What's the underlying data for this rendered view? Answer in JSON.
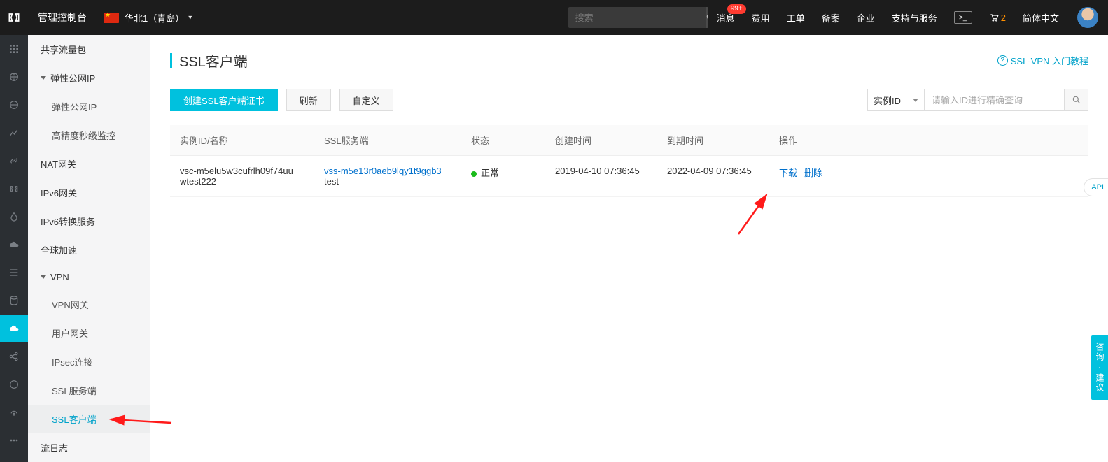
{
  "header": {
    "console_label": "管理控制台",
    "region": "华北1（青岛）",
    "search_placeholder": "搜索",
    "msg_label": "消息",
    "msg_badge": "99+",
    "fee_label": "费用",
    "ticket_label": "工单",
    "beian_label": "备案",
    "enterprise_label": "企业",
    "support_label": "支持与服务",
    "cart_count": "2",
    "lang_label": "简体中文"
  },
  "sidebar": {
    "shared_flow": "共享流量包",
    "eip_group": "弹性公网IP",
    "eip": "弹性公网IP",
    "hp_monitor": "高精度秒级监控",
    "nat": "NAT网关",
    "ipv6gw": "IPv6网关",
    "ipv6trans": "IPv6转换服务",
    "global_accel": "全球加速",
    "vpn_group": "VPN",
    "vpn_gw": "VPN网关",
    "user_gw": "用户网关",
    "ipsec": "IPsec连接",
    "ssl_server": "SSL服务端",
    "ssl_client": "SSL客户端",
    "flow_log": "流日志"
  },
  "page": {
    "title": "SSL客户端",
    "help_link": "SSL-VPN 入门教程"
  },
  "toolbar": {
    "create_btn": "创建SSL客户端证书",
    "refresh_btn": "刷新",
    "custom_btn": "自定义",
    "filter_type": "实例ID",
    "filter_placeholder": "请输入ID进行精确查询"
  },
  "table": {
    "headers": {
      "id_name": "实例ID/名称",
      "ssl_server": "SSL服务端",
      "status": "状态",
      "create_time": "创建时间",
      "expire_time": "到期时间",
      "ops": "操作"
    },
    "row": {
      "id": "vsc-m5elu5w3cufrlh09f74uu",
      "name": "wtest222",
      "ssl_server_id": "vss-m5e13r0aeb9lqy1t9ggb3",
      "ssl_server_name": "test",
      "status": "正常",
      "create_time": "2019-04-10 07:36:45",
      "expire_time": "2022-04-09 07:36:45",
      "op_download": "下载",
      "op_delete": "删除"
    }
  },
  "floating": {
    "api_label": "API",
    "feedback": "咨询·建议"
  }
}
